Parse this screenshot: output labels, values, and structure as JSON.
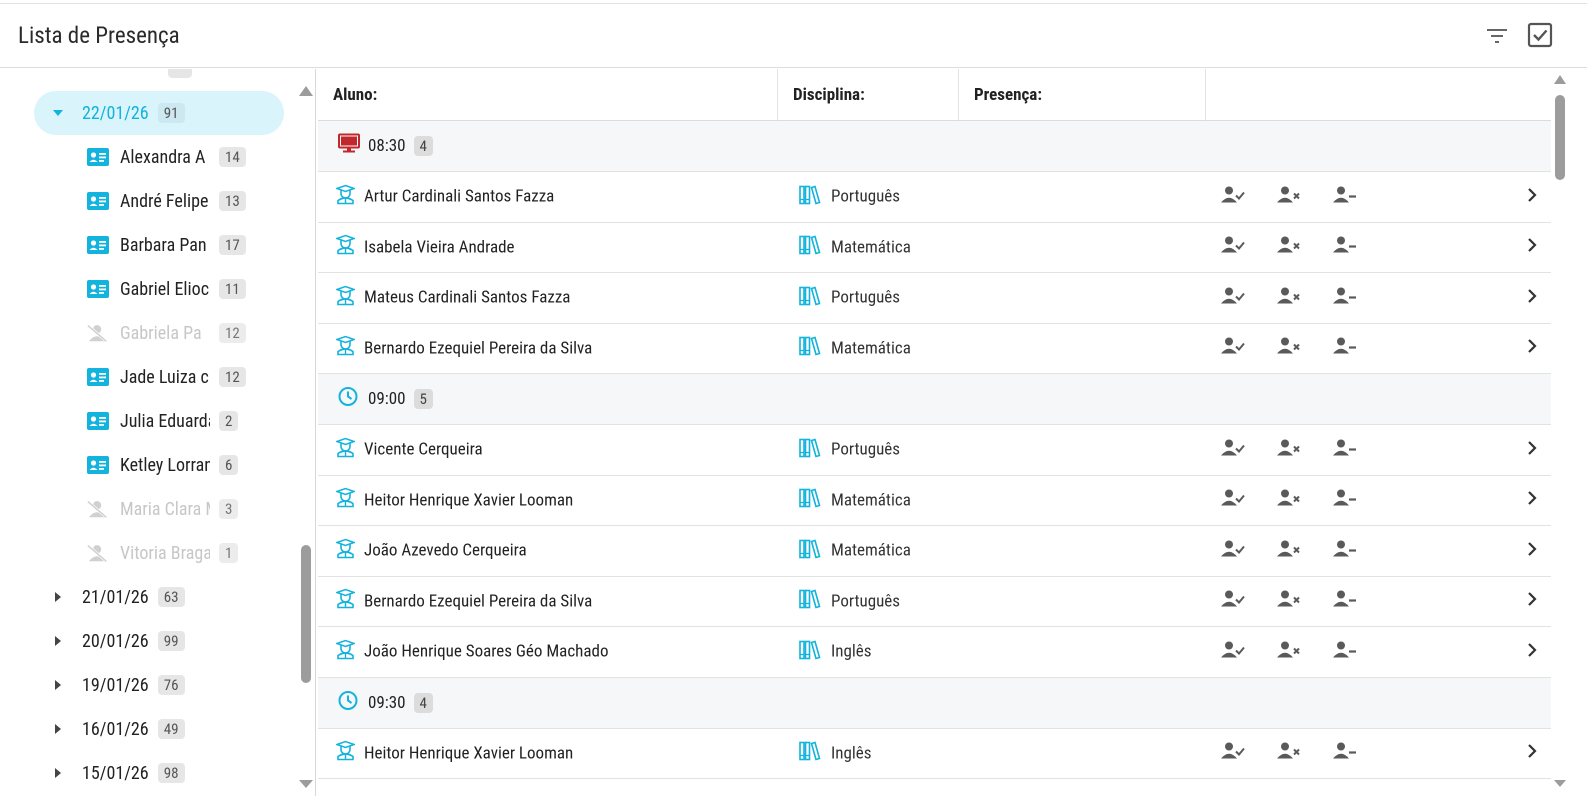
{
  "header": {
    "title": "Lista de Presença"
  },
  "sidebar": {
    "top_badge": "",
    "active_date": {
      "label": "22/01/26",
      "count": "91"
    },
    "children": [
      {
        "name": "Alexandra A",
        "count": "14",
        "active": true
      },
      {
        "name": "André Felipe",
        "count": "13",
        "active": true
      },
      {
        "name": "Barbara Pan",
        "count": "17",
        "active": true
      },
      {
        "name": "Gabriel Elioc",
        "count": "11",
        "active": true
      },
      {
        "name": "Gabriela Pa",
        "count": "12",
        "active": false
      },
      {
        "name": "Jade Luiza c",
        "count": "12",
        "active": true
      },
      {
        "name": "Julia Eduarda",
        "count": "2",
        "active": true
      },
      {
        "name": "Ketley Lorran",
        "count": "6",
        "active": true
      },
      {
        "name": "Maria Clara M",
        "count": "3",
        "active": false
      },
      {
        "name": "Vitoria Braga",
        "count": "1",
        "active": false
      }
    ],
    "dates": [
      {
        "label": "21/01/26",
        "count": "63"
      },
      {
        "label": "20/01/26",
        "count": "99"
      },
      {
        "label": "19/01/26",
        "count": "76"
      },
      {
        "label": "16/01/26",
        "count": "49"
      },
      {
        "label": "15/01/26",
        "count": "98"
      }
    ]
  },
  "table": {
    "columns": {
      "student": "Aluno:",
      "subject": "Disciplina:",
      "presence": "Presença:"
    },
    "groups": [
      {
        "time": "08:30",
        "count": "4",
        "icon": "monitor-icon",
        "rows": [
          {
            "student": "Artur Cardinali Santos Fazza",
            "subject": "Português"
          },
          {
            "student": "Isabela Vieira Andrade",
            "subject": "Matemática"
          },
          {
            "student": "Mateus Cardinali Santos Fazza",
            "subject": "Português"
          },
          {
            "student": "Bernardo Ezequiel Pereira da Silva",
            "subject": "Matemática"
          }
        ]
      },
      {
        "time": "09:00",
        "count": "5",
        "icon": "clock-icon",
        "rows": [
          {
            "student": "Vicente Cerqueira",
            "subject": "Português"
          },
          {
            "student": "Heitor Henrique Xavier Looman",
            "subject": "Matemática"
          },
          {
            "student": "João Azevedo Cerqueira",
            "subject": "Matemática"
          },
          {
            "student": "Bernardo Ezequiel Pereira da Silva",
            "subject": "Português"
          },
          {
            "student": "João Henrique Soares Géo Machado",
            "subject": "Inglês"
          }
        ]
      },
      {
        "time": "09:30",
        "count": "4",
        "icon": "clock-icon",
        "rows": [
          {
            "student": "Heitor Henrique Xavier Looman",
            "subject": "Inglês"
          }
        ]
      }
    ]
  },
  "colors": {
    "accent": "#12b3dd",
    "active_bg": "#d9f4fb",
    "monitor_red": "#c0282d",
    "icon_gray": "#5a5a5a"
  }
}
